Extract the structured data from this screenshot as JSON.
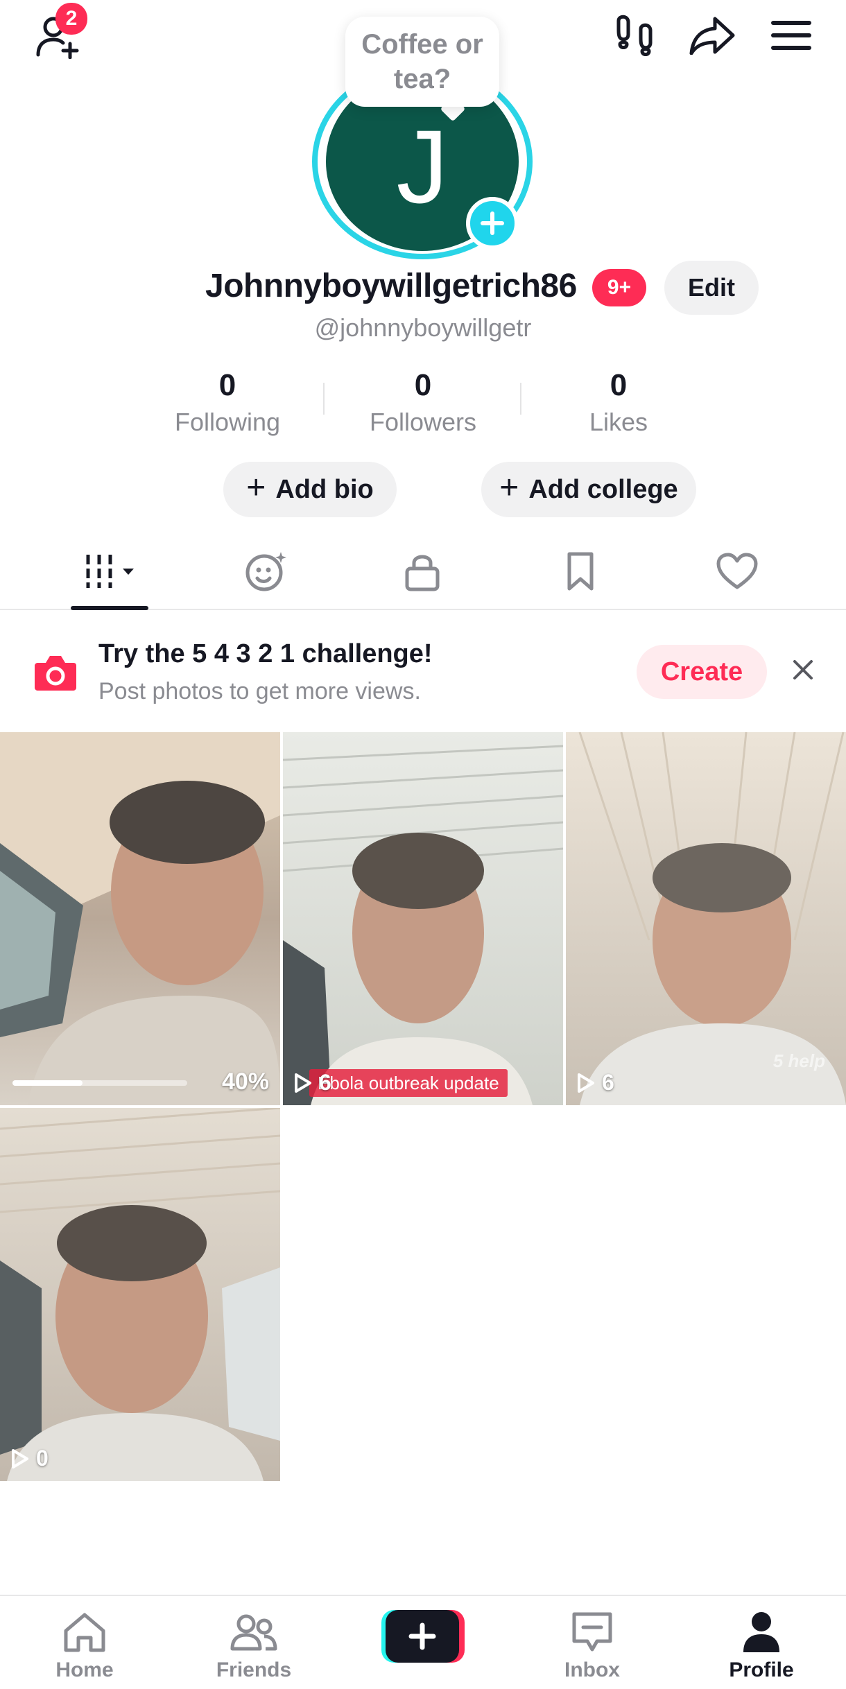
{
  "top_bar": {
    "add_friends_badge": "2",
    "icons": [
      "add-friends-icon",
      "footprints-icon",
      "share-icon",
      "menu-icon"
    ]
  },
  "profile": {
    "avatar_letter": "J",
    "note_bubble": "Coffee or tea?",
    "display_name": "Johnnyboywillgetrich86",
    "name_badge": "9+",
    "edit_label": "Edit",
    "handle": "@johnnyboywillgetr"
  },
  "stats": [
    {
      "value": "0",
      "label": "Following"
    },
    {
      "value": "0",
      "label": "Followers"
    },
    {
      "value": "0",
      "label": "Likes"
    }
  ],
  "actions": {
    "add_bio": "Add bio",
    "add_college": "Add college"
  },
  "tabs": [
    "videos-grid-icon",
    "reposts-icon",
    "private-lock-icon",
    "favorites-bookmark-icon",
    "liked-heart-icon"
  ],
  "banner": {
    "title": "Try the 5 4 3 2 1 challenge!",
    "subtitle": "Post photos to get more views.",
    "create_label": "Create"
  },
  "videos": [
    {
      "upload_progress_percent": 40,
      "progress_label": "40%"
    },
    {
      "views": "6",
      "caption": "Ebola outbreak update"
    },
    {
      "views": "6",
      "watermark": "5 help"
    },
    {
      "views": "0"
    }
  ],
  "bottom_nav": {
    "home": "Home",
    "friends": "Friends",
    "inbox": "Inbox",
    "profile": "Profile",
    "active": "profile"
  },
  "colors": {
    "accent": "#fe2c55",
    "avatar_ring": "#2ad4e6",
    "avatar_bg": "#0c5749",
    "muted_text": "#8a8b91"
  }
}
